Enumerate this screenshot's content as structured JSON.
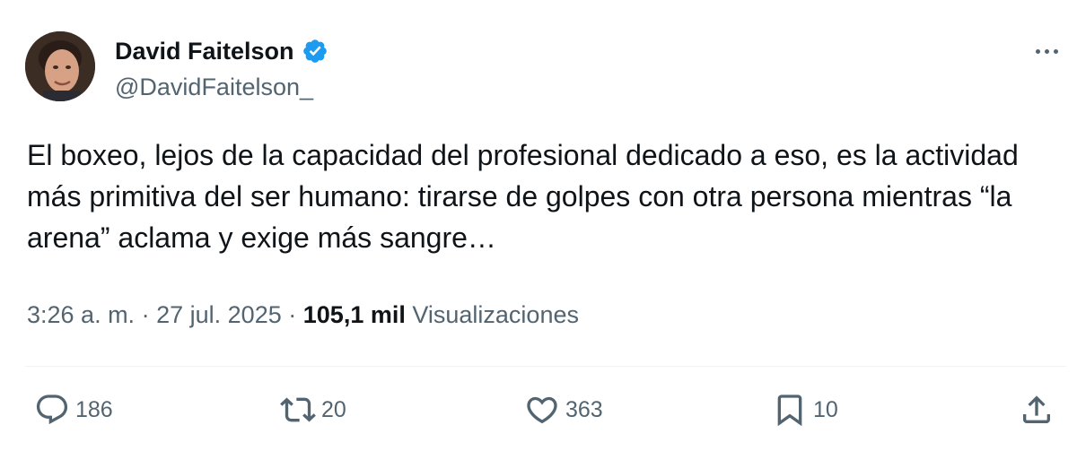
{
  "author": {
    "display_name": "David Faitelson",
    "handle": "@DavidFaitelson_",
    "verified": true
  },
  "tweet": {
    "text": "El boxeo, lejos de la capacidad del profesional dedicado a eso, es la actividad más primitiva del ser humano: tirarse de golpes con otra persona mientras “la arena” aclama y exige más sangre…",
    "time": "3:26 a. m.",
    "date": "27 jul. 2025",
    "separator": "·",
    "views_count": "105,1 mil",
    "views_label": "Visualizaciones"
  },
  "actions": {
    "replies": "186",
    "reposts": "20",
    "likes": "363",
    "bookmarks": "10"
  },
  "icons": [
    "more-icon",
    "verified-icon",
    "reply-icon",
    "repost-icon",
    "like-icon",
    "bookmark-icon",
    "share-icon"
  ],
  "colors": {
    "text": "#0f1419",
    "secondary": "#536471",
    "verified_badge": "#1d9bf0",
    "divider": "#eff3f4"
  }
}
